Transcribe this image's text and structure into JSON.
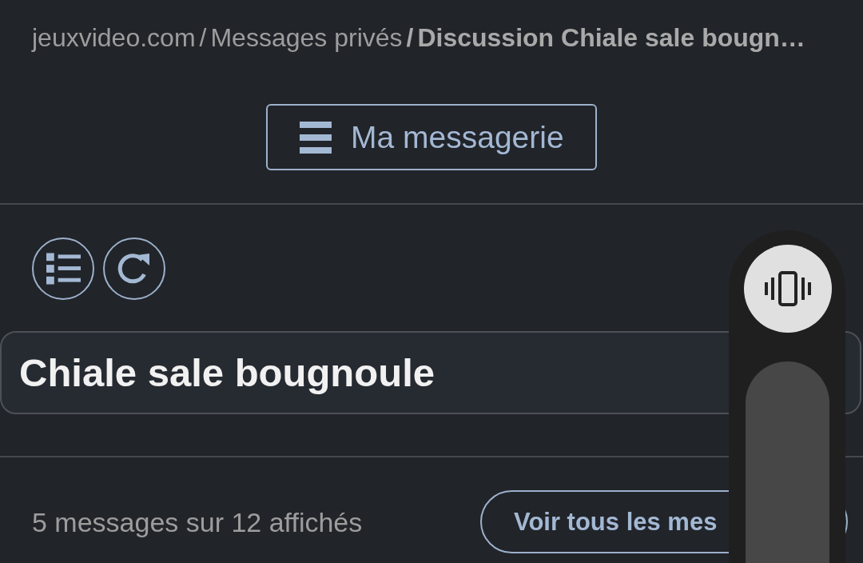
{
  "breadcrumb": [
    {
      "label": "jeuxvideo.com",
      "kind": "link"
    },
    {
      "separator": "/",
      "label": "Messages privés",
      "kind": "link"
    },
    {
      "separator": "/",
      "label": "Discussion Chiale sale bougn…",
      "kind": "current"
    }
  ],
  "messagerie_button": {
    "label": "Ma messagerie"
  },
  "discussion": {
    "title": "Chiale sale bougnoule"
  },
  "pagination": {
    "summary": "5 messages sur 12 affichés",
    "button": "Voir tous les mes"
  }
}
